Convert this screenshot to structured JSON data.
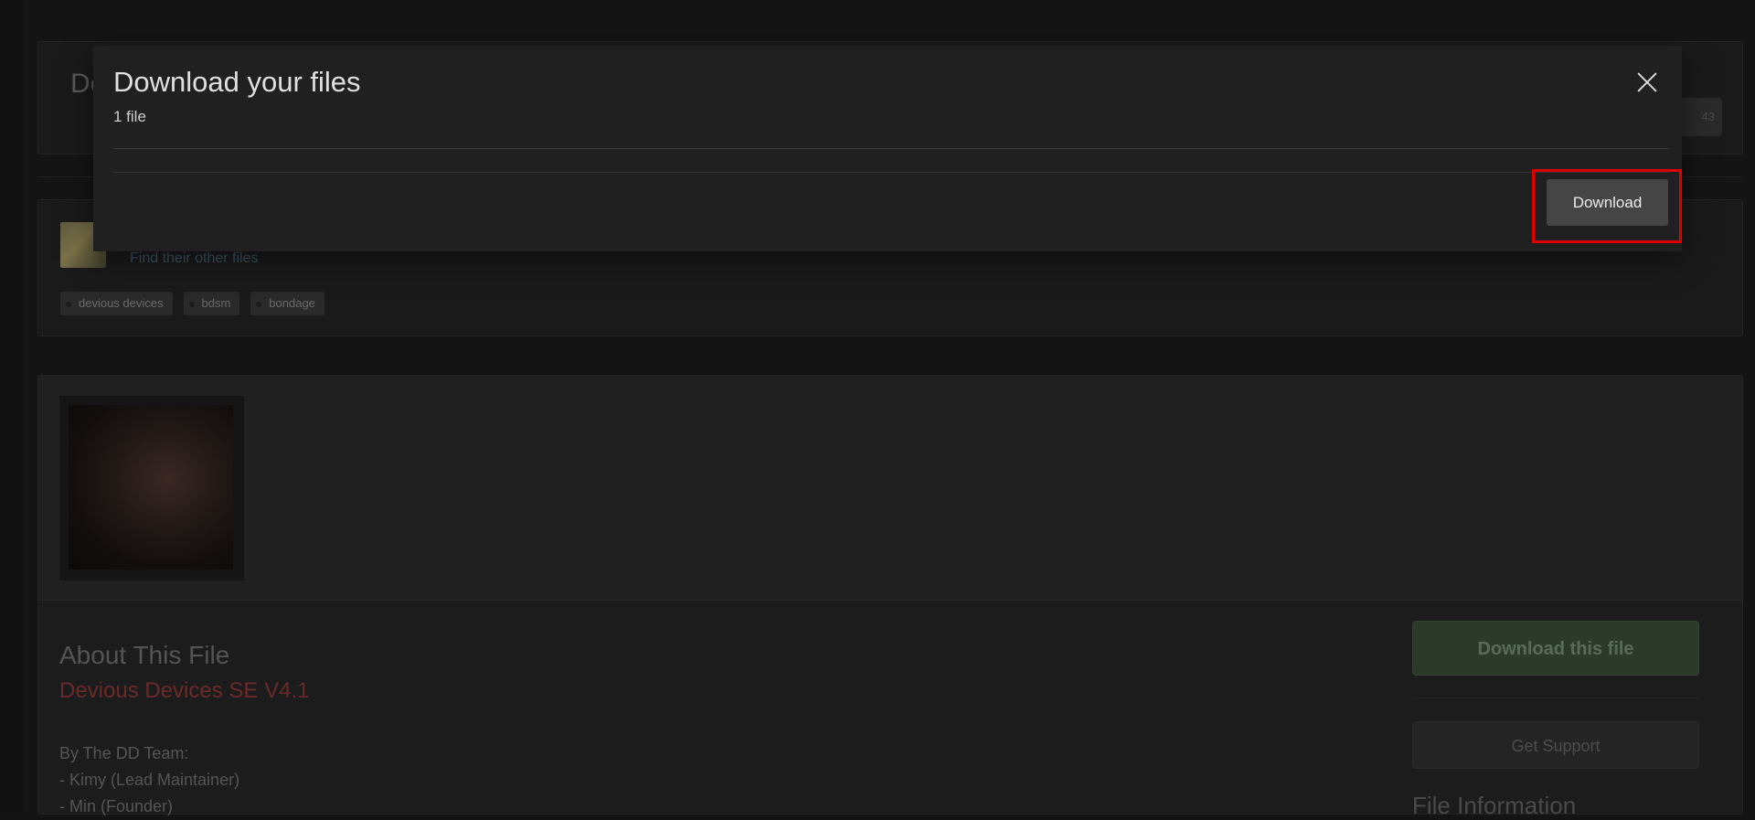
{
  "background": {
    "title_peek": "De",
    "count_badge": "43",
    "other_files_link": "Find their other files",
    "tags": [
      "devious devices",
      "bdsm",
      "bondage"
    ],
    "about_title": "About This File",
    "release_title": "Devious Devices SE V4.1",
    "description_lines": [
      "By The DD Team:",
      "- Kimy (Lead Maintainer)",
      "- Min (Founder)"
    ],
    "download_this_file": "Download this file",
    "get_support": "Get Support",
    "file_information": "File Information"
  },
  "modal": {
    "title": "Download your files",
    "subtitle": "1 file",
    "download_label": "Download",
    "close_icon": "close-icon"
  },
  "colors": {
    "highlight": "#e00000",
    "accent_green": "#2c3a2c",
    "release_red": "#6b2a2a"
  }
}
